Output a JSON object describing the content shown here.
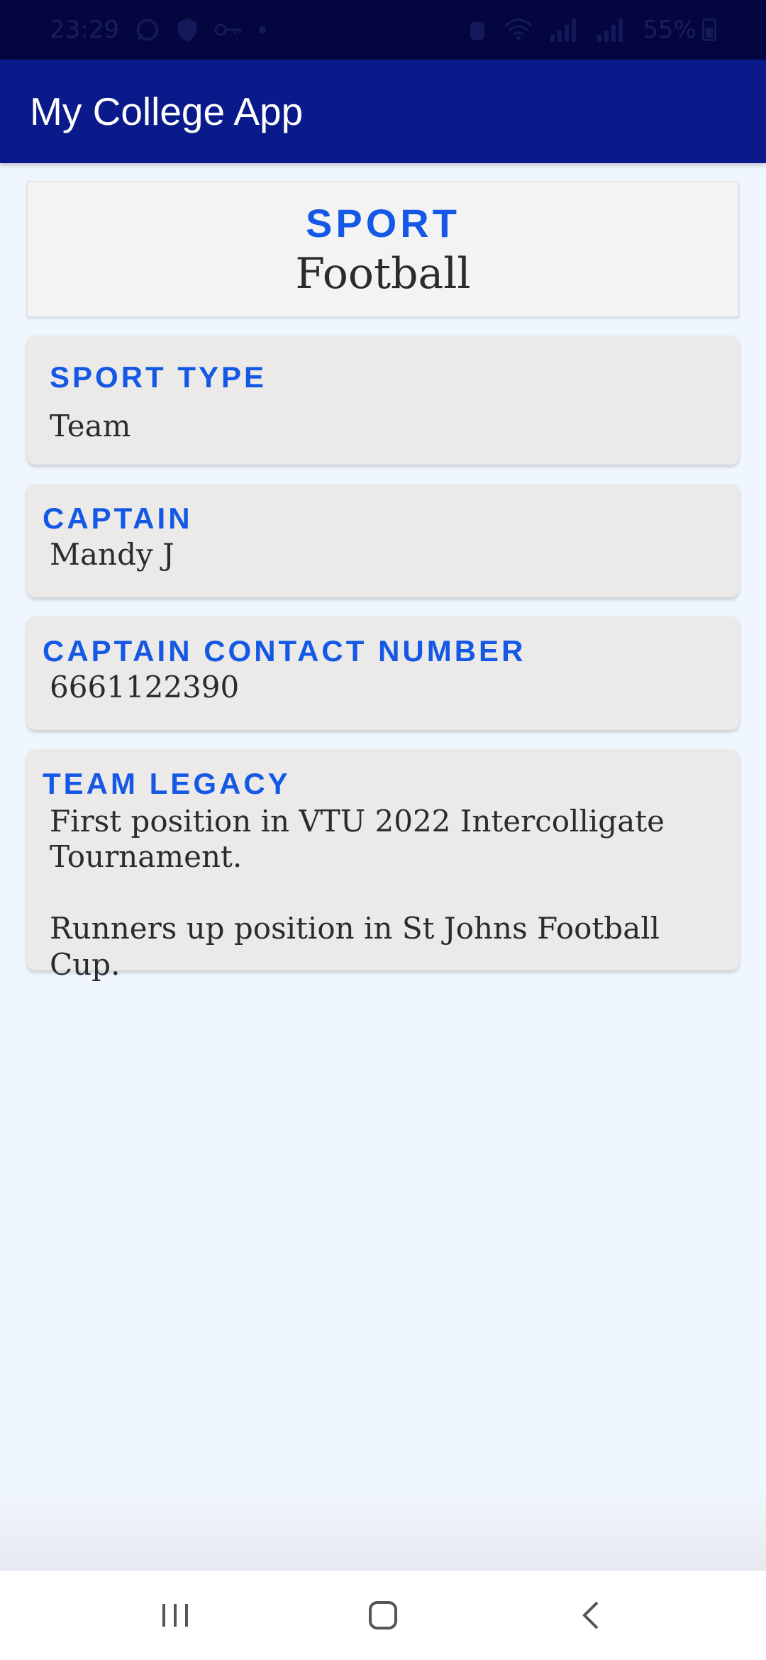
{
  "status_bar": {
    "time": "23:29",
    "battery": "55%",
    "icons": [
      "whatsapp-icon",
      "shield-icon",
      "key-icon",
      "dot-icon",
      "alarm-icon",
      "wifi-icon",
      "signal-icon",
      "signal-icon",
      "battery-icon"
    ]
  },
  "app_bar": {
    "title": "My College App"
  },
  "hero": {
    "label": "SPORT",
    "value": "Football"
  },
  "details": {
    "sport_type_label": "SPORT TYPE",
    "sport_type_value": "Team",
    "captain_label": "CAPTAIN",
    "captain_value": "Mandy J",
    "contact_label": "CAPTAIN CONTACT NUMBER",
    "contact_value": "6661122390",
    "legacy_label": "TEAM LEGACY",
    "legacy_value": "First position in VTU 2022 Intercolligate\nTournament.\n\nRunners up position in St Johns Football Cup."
  },
  "nav": {
    "icons": [
      "recent-apps-icon",
      "home-icon",
      "back-icon"
    ]
  },
  "colors": {
    "status_bar": "#04063f",
    "app_bar": "#0a1a8a",
    "accent": "#1558e6",
    "background": "#f0f6fe",
    "card": "#ebeae8"
  }
}
